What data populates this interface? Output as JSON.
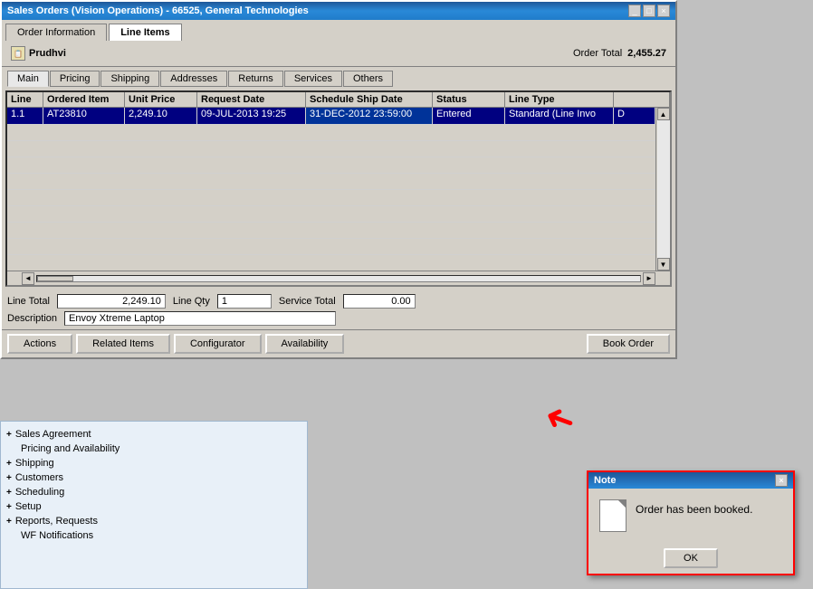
{
  "titleBar": {
    "text": "Sales Orders (Vision Operations) - 66525, General Technologies",
    "controls": [
      "_",
      "□",
      "×"
    ]
  },
  "topTabs": [
    {
      "label": "Order Information",
      "active": false
    },
    {
      "label": "Line Items",
      "active": true
    }
  ],
  "userInfo": {
    "name": "Prudhvi",
    "orderTotalLabel": "Order Total",
    "orderTotalValue": "2,455.27"
  },
  "subTabs": [
    {
      "label": "Main",
      "active": true
    },
    {
      "label": "Pricing"
    },
    {
      "label": "Shipping"
    },
    {
      "label": "Addresses"
    },
    {
      "label": "Returns"
    },
    {
      "label": "Services"
    },
    {
      "label": "Others"
    }
  ],
  "gridHeaders": [
    {
      "label": "Line",
      "key": "line"
    },
    {
      "label": "Ordered Item",
      "key": "ordered_item"
    },
    {
      "label": "Unit Price",
      "key": "unit_price"
    },
    {
      "label": "Request Date",
      "key": "request_date"
    },
    {
      "label": "Schedule Ship Date",
      "key": "schedule_ship_date"
    },
    {
      "label": "Status",
      "key": "status"
    },
    {
      "label": "Line Type",
      "key": "line_type"
    },
    {
      "label": "...",
      "key": "extra"
    }
  ],
  "gridRows": [
    {
      "line": "1.1",
      "ordered_item": "AT23810",
      "unit_price": "2,249.10",
      "request_date": "09-JUL-2013 19:25",
      "schedule_ship_date": "31-DEC-2012 23:59:00",
      "status": "Entered",
      "line_type": "Standard (Line Invo",
      "extra": "D"
    }
  ],
  "bottomInfo": {
    "lineTotalLabel": "Line Total",
    "lineTotalValue": "2,249.10",
    "lineQtyLabel": "Line Qty",
    "lineQtyValue": "1",
    "serviceTotalLabel": "Service Total",
    "serviceTotalValue": "0.00",
    "descriptionLabel": "Description",
    "descriptionValue": "Envoy Xtreme Laptop"
  },
  "actionButtons": [
    {
      "label": "Actions",
      "key": "actions"
    },
    {
      "label": "Related Items",
      "key": "related_items"
    },
    {
      "label": "Configurator",
      "key": "configurator"
    },
    {
      "label": "Availability",
      "key": "availability"
    },
    {
      "label": "Book Order",
      "key": "book_order"
    }
  ],
  "sidebarItems": [
    {
      "label": "Sales Agreement",
      "type": "plus",
      "bold": false
    },
    {
      "label": "Pricing and Availability",
      "type": "text",
      "bold": false
    },
    {
      "label": "Shipping",
      "type": "plus",
      "bold": false
    },
    {
      "label": "Customers",
      "type": "plus",
      "bold": false
    },
    {
      "label": "Scheduling",
      "type": "plus",
      "bold": false
    },
    {
      "label": "Setup",
      "type": "plus",
      "bold": false
    },
    {
      "label": "Reports, Requests",
      "type": "plus",
      "bold": false
    },
    {
      "label": "WF Notifications",
      "type": "text",
      "bold": false
    }
  ],
  "noteDialog": {
    "title": "Note",
    "message": "Order has been booked.",
    "okLabel": "OK"
  },
  "colors": {
    "selectedRow": "#000080",
    "highlightedCell": "#003399",
    "redBorder": "#ff0000"
  }
}
